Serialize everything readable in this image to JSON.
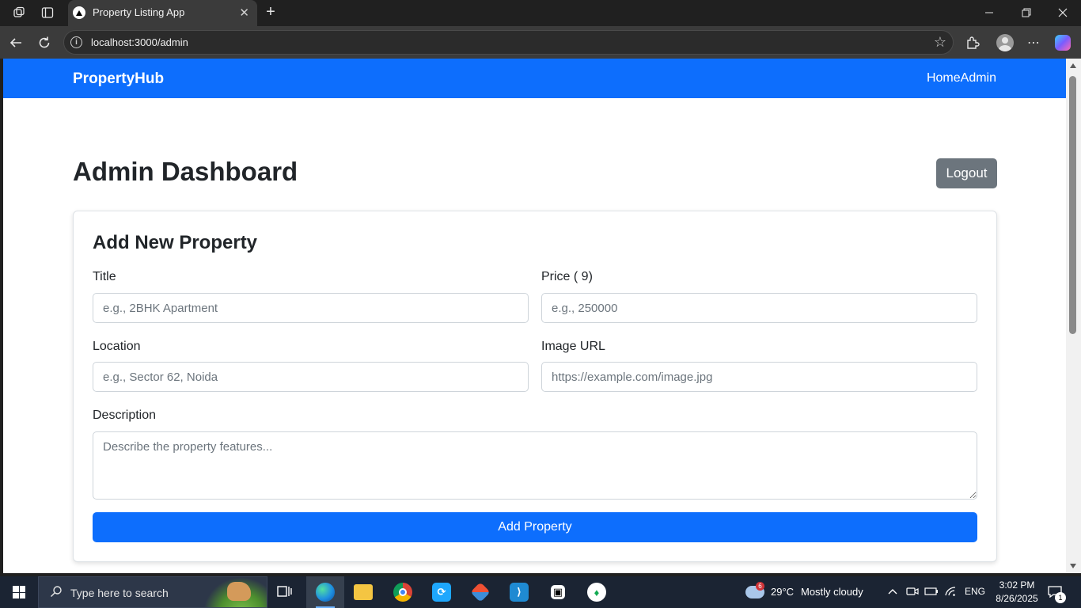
{
  "browser": {
    "tab": {
      "title": "Property Listing App"
    },
    "address": {
      "url": "localhost:3000/admin"
    }
  },
  "app": {
    "brand": "PropertyHub",
    "nav": {
      "home": "Home",
      "admin": "Admin"
    },
    "colors": {
      "primary": "#0d6efd",
      "secondary": "#6c757d"
    }
  },
  "dashboard": {
    "title": "Admin Dashboard",
    "logout_label": "Logout"
  },
  "form": {
    "heading": "Add New Property",
    "title_label": "Title",
    "title_placeholder": "e.g., 2BHK Apartment",
    "price_label": "Price ( 9)",
    "price_placeholder": "e.g., 250000",
    "location_label": "Location",
    "location_placeholder": "e.g., Sector 62, Noida",
    "image_label": "Image URL",
    "image_placeholder": "https://example.com/image.jpg",
    "description_label": "Description",
    "description_placeholder": "Describe the property features...",
    "submit_label": "Add Property"
  },
  "taskbar": {
    "search_placeholder": "Type here to search",
    "apps": [
      "task-view-icon",
      "edge-icon",
      "file-explorer-icon",
      "chrome-icon",
      "app-icon",
      "git-icon",
      "vscode-icon",
      "terminal-icon",
      "mongodb-icon"
    ],
    "weather": {
      "temp": "29°C",
      "condition": "Mostly cloudy",
      "badge": "6"
    },
    "language": "ENG",
    "time": "3:02 PM",
    "date": "8/26/2025",
    "notifications": "1"
  }
}
